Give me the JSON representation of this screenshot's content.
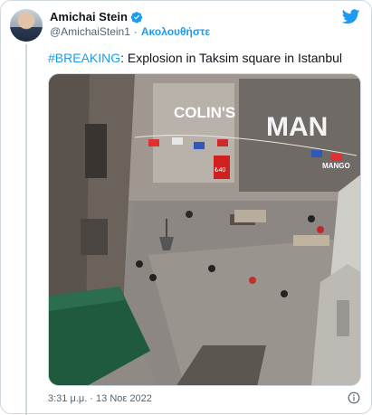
{
  "author": {
    "name": "Amichai Stein",
    "handle": "@AmichaiStein1",
    "follow_label": "Ακολουθήστε"
  },
  "tweet": {
    "hashtag": "#BREAKING",
    "text": ": Explosion in Taksim square in Istanbul"
  },
  "media": {
    "signs": {
      "store1": "COLIN'S",
      "store2": "MAN",
      "store2_sub": "MANGO",
      "price": "₺40"
    }
  },
  "footer": {
    "timestamp": "3:31 μ.μ. · 13 Νοε 2022"
  },
  "colors": {
    "accent": "#1d9bf0",
    "text": "#0f1419",
    "muted": "#536471",
    "border": "#cfd9de"
  },
  "icons": [
    "verified-badge-icon",
    "twitter-bird-icon",
    "info-icon"
  ]
}
